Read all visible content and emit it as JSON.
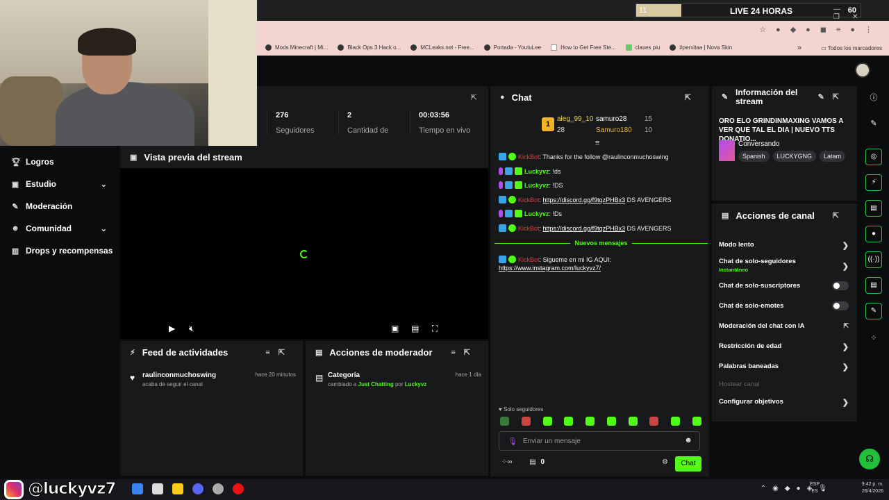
{
  "browser": {
    "live_counter": "11",
    "live_title": "LIVE 24 HORAS",
    "live_value": "60",
    "bookmarks": [
      "Mods Minecraft | Mi...",
      "Black Ops 3 Hack o...",
      "MCLeaks.net - Free...",
      "Portada - YoutuLee",
      "How to Get Free Ste...",
      "clases piu",
      "#perxitaa | Nova Skin"
    ],
    "bookmarks_more": "»",
    "bookmarks_folder": "Todos los marcadores"
  },
  "sidebar": {
    "items": [
      {
        "label": "Logros",
        "icon": "trophy-icon"
      },
      {
        "label": "Estudio",
        "icon": "studio-icon"
      },
      {
        "label": "Moderación",
        "icon": "wrench-icon"
      },
      {
        "label": "Comunidad",
        "icon": "community-icon"
      },
      {
        "label": "Drops y recompensas",
        "icon": "drops-icon"
      }
    ]
  },
  "stats": {
    "followers_value": "276",
    "followers_label": "Seguidores",
    "count_value": "2",
    "count_label": "Cantidad de",
    "time_value": "00:03:56",
    "time_label": "Tiempo en vivo"
  },
  "preview": {
    "title": "Vista previa del stream"
  },
  "feed": {
    "title": "Feed de actividades",
    "item_user": "raulinconmuchoswing",
    "item_text": "acaba de seguir el canal",
    "item_time": "hace 20 minutos"
  },
  "modactions": {
    "title": "Acciones de moderador",
    "item_title": "Categoría",
    "item_pre": "cambiado a",
    "item_cat": "Just Chatting",
    "item_por": "por",
    "item_user": "Luckyvz",
    "item_time": "hace 1 día"
  },
  "chat": {
    "title": "Chat",
    "pinned": {
      "rank": "1",
      "user1": "aleg_99_10",
      "user1_count": "28",
      "user2": "samuro28",
      "user2_count": "15",
      "user3": "Samuro180",
      "user3_count": "10"
    },
    "messages": [
      {
        "user": "KickBot",
        "text": ": Thanks for the follow @raulinconmuchoswing"
      },
      {
        "user": "Luckyvz",
        "text": ": !ds"
      },
      {
        "user": "Luckyvz",
        "text": ": !DS"
      },
      {
        "user": "KickBot",
        "link": "https://discord.gg/f9tqzPHBx3",
        "text": " DS AVENGERS"
      },
      {
        "user": "Luckyvz",
        "text": ": !Ds"
      },
      {
        "user": "KickBot",
        "link": "https://discord.gg/f9tqzPHBx3",
        "text": " DS AVENGERS"
      }
    ],
    "new_messages": "Nuevos mensajes",
    "last": {
      "user": "KickBot",
      "text": ": Sigueme en mi IG AQUI:",
      "link": "https://www.instagram.com/luckyvz7/"
    },
    "solo": "Solo seguidores",
    "placeholder": "Enviar un mensaje",
    "points": "0",
    "send": "Chat"
  },
  "info": {
    "title": "Información del stream",
    "stream_title": "ORO ELO GRINDINMAXING VAMOS A VER QUE TAL EL DIA | NUEVO TTS DONATIO...",
    "category": "Conversando",
    "tags": [
      "Spanish",
      "LUCKYGNG",
      "Latam"
    ]
  },
  "canal": {
    "title": "Acciones de canal",
    "rows": [
      {
        "label": "Modo lento"
      },
      {
        "label": "Chat de solo-seguidores",
        "sub": "Instantáneo"
      },
      {
        "label": "Chat de solo-suscriptores"
      },
      {
        "label": "Chat de solo-emotes"
      },
      {
        "label": "Moderación del chat con IA"
      },
      {
        "label": "Restricción de edad"
      },
      {
        "label": "Palabras baneadas"
      },
      {
        "label": "Hostear canal"
      },
      {
        "label": "Configurar objetivos"
      }
    ]
  },
  "taskbar": {
    "handle": "@luckyvz7",
    "lang1": "ESP",
    "lang2": "ES",
    "time": "9:42 p. m.",
    "date": "26/4/2026"
  },
  "colors": {
    "accent": "#53fc18",
    "panel": "#18191b",
    "bg": "#0b0c0d"
  }
}
